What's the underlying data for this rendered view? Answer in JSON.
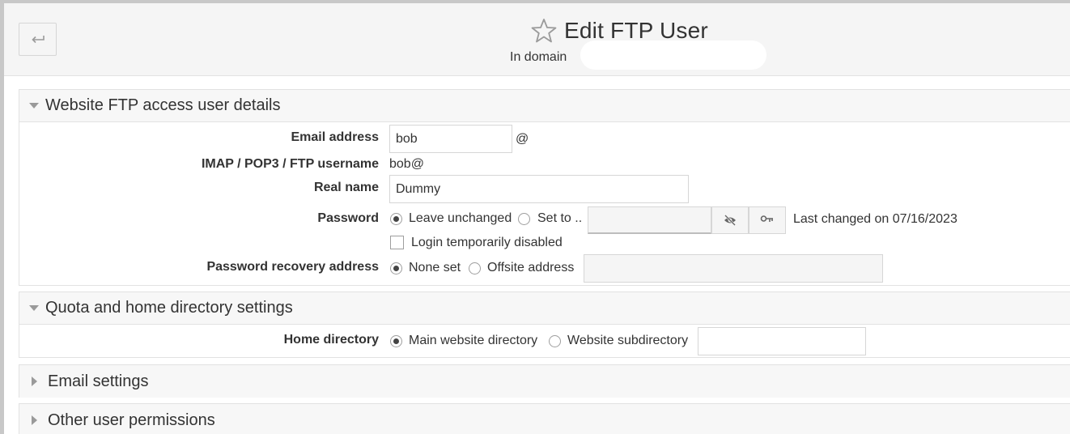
{
  "header": {
    "back_icon": "return-arrow-icon",
    "star_icon": "star-outline-icon",
    "title": "Edit FTP User",
    "subtitle": "In domain"
  },
  "sections": {
    "ftp_details": {
      "title": "Website FTP access user details",
      "expanded": true,
      "email_label": "Email address",
      "email_value": "bob",
      "email_at": "@",
      "username_label": "IMAP / POP3 / FTP username",
      "username_value": "bob@",
      "realname_label": "Real name",
      "realname_value": "Dummy",
      "password_label": "Password",
      "password_leave": "Leave unchanged",
      "password_set": "Set to ..",
      "password_value": "",
      "show_password_icon": "eye-slash-icon",
      "generate_password_icon": "key-icon",
      "password_last_changed": "Last changed on 07/16/2023",
      "login_disabled_label": "Login temporarily disabled",
      "recovery_label": "Password recovery address",
      "recovery_none": "None set",
      "recovery_offsite": "Offsite address",
      "recovery_value": ""
    },
    "quota": {
      "title": "Quota and home directory settings",
      "expanded": true,
      "home_label": "Home directory",
      "home_main": "Main website directory",
      "home_sub": "Website subdirectory",
      "home_sub_value": ""
    },
    "email_settings": {
      "title": "Email settings",
      "expanded": false
    },
    "other_permissions": {
      "title": "Other user permissions",
      "expanded": false
    }
  }
}
